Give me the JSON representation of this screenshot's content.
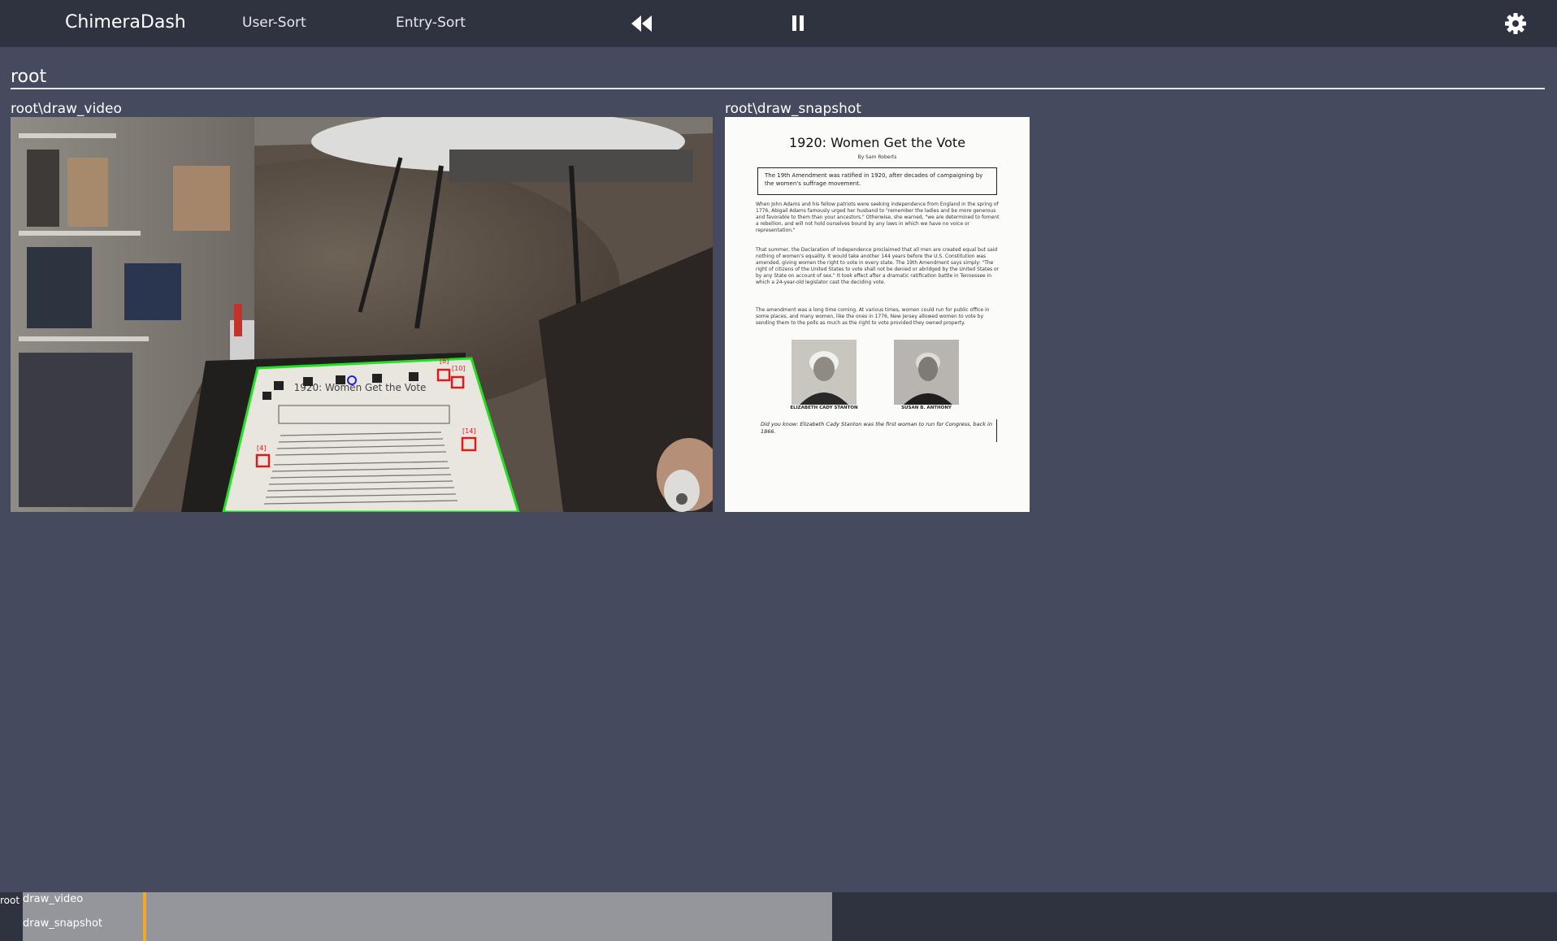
{
  "app": {
    "brand": "ChimeraDash",
    "nav": [
      {
        "label": "User-Sort"
      },
      {
        "label": "Entry-Sort"
      }
    ],
    "controls": {
      "rewind_icon": "rewind-icon",
      "pause_icon": "pause-icon",
      "settings_icon": "gear-icon"
    }
  },
  "section": {
    "title": "root"
  },
  "panels": {
    "video": {
      "label": "root\\draw_video",
      "markers": [
        "[8]",
        "[10]",
        "[4]",
        "[14]"
      ]
    },
    "snapshot": {
      "label": "root\\draw_snapshot",
      "document": {
        "title": "1920: Women Get the Vote",
        "byline": "By Sam Roberts",
        "summary": "The 19th Amendment was ratified in 1920, after decades of campaigning by the women's suffrage movement.",
        "paragraphs": [
          "When John Adams and his fellow patriots were seeking independence from England in the spring of 1776, Abigail Adams famously urged her husband to \"remember the ladies and be more generous and favorable to them than your ancestors.\" Otherwise, she warned, \"we are determined to foment a rebellion, and will not hold ourselves bound by any laws in which we have no voice or representation.\"",
          "That summer, the Declaration of Independence proclaimed that all men are created equal but said nothing of women's equality. It would take another 144 years before the U.S. Constitution was amended, giving women the right to vote in every state. The 19th Amendment says simply: \"The right of citizens of the United States to vote shall not be denied or abridged by the United States or by any State on account of sex.\" It took effect after a dramatic ratification battle in Tennessee in which a 24-year-old legislator cast the deciding vote.",
          "The amendment was a long time coming. At various times, women could run for public office in some places, and many women, like the ones in 1776, New Jersey allowed women to vote by sending them to the polls as much as the right to vote provided they owned property."
        ],
        "captions": [
          "ELIZABETH CADY STANTON",
          "SUSAN B. ANTHONY"
        ],
        "did_you_know": "Did you know: Elizabeth Cady Stanton was the first woman to run for Congress, back in 1866."
      }
    }
  },
  "timeline": {
    "root_label": "root",
    "tracks": [
      {
        "label": "draw_video"
      },
      {
        "label": "draw_snapshot"
      }
    ],
    "colors": {
      "track": "#95969c",
      "cursor": "#f5a623"
    }
  }
}
